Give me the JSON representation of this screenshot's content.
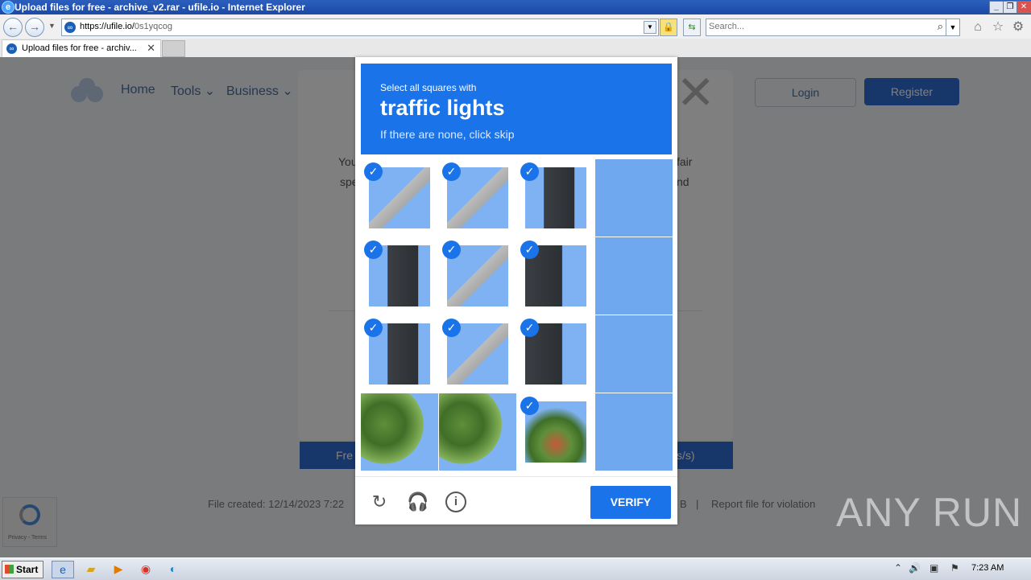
{
  "window": {
    "title": "Upload files for free - archive_v2.rar - ufile.io - Internet Explorer",
    "min_label": "_",
    "restore_label": "❐",
    "close_label": "✕"
  },
  "browser": {
    "url_host": "https://ufile.io/",
    "url_path": "0s1yqcog",
    "search_placeholder": "Search...",
    "tab_title": "Upload files for free - archiv...",
    "tab_close": "✕"
  },
  "site": {
    "nav": [
      "Home",
      "Tools",
      "Business"
    ],
    "login": "Login",
    "register": "Register",
    "dialog_fragments": [
      "You",
      "spe",
      "fair",
      "nd"
    ],
    "free_button_left": "Fre",
    "free_button_right": "s/s)",
    "file_created": "File created: 12/14/2023 7:22",
    "file_size_tail": "B",
    "report": "Report file for violation",
    "recaptcha_text": "Privacy - Terms",
    "close_dialog": "✕"
  },
  "captcha": {
    "prompt_small": "Select all squares with",
    "prompt_target": "traffic lights",
    "prompt_hint": "If there are none, click skip",
    "verify_label": "VERIFY",
    "check_mark": "✓",
    "tiles": [
      {
        "selected": true,
        "kind": "pole"
      },
      {
        "selected": true,
        "kind": "pole"
      },
      {
        "selected": true,
        "kind": "light"
      },
      {
        "selected": false,
        "kind": "sky"
      },
      {
        "selected": true,
        "kind": "light"
      },
      {
        "selected": true,
        "kind": "pole"
      },
      {
        "selected": true,
        "kind": "light2"
      },
      {
        "selected": false,
        "kind": "sky"
      },
      {
        "selected": true,
        "kind": "light"
      },
      {
        "selected": true,
        "kind": "pole"
      },
      {
        "selected": true,
        "kind": "light2"
      },
      {
        "selected": false,
        "kind": "sky"
      },
      {
        "selected": false,
        "kind": "tree"
      },
      {
        "selected": false,
        "kind": "tree"
      },
      {
        "selected": true,
        "kind": "tree2"
      },
      {
        "selected": false,
        "kind": "sky"
      }
    ],
    "accent_color": "#1a73e8"
  },
  "watermark": "ANY RUN",
  "taskbar": {
    "start_label": "Start",
    "clock": "7:23 AM"
  }
}
